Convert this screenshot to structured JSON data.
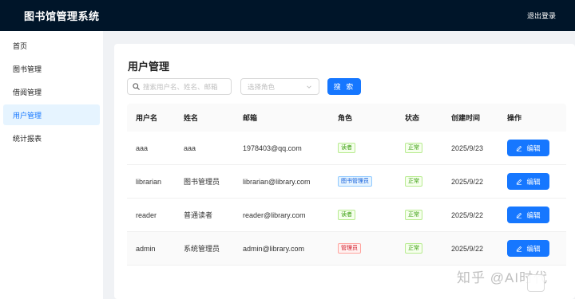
{
  "header": {
    "title": "图书馆管理系统",
    "logout_label": "退出登录"
  },
  "sidebar": {
    "items": [
      {
        "label": "首页"
      },
      {
        "label": "图书管理"
      },
      {
        "label": "借阅管理"
      },
      {
        "label": "用户管理",
        "active": true
      },
      {
        "label": "统计报表"
      }
    ]
  },
  "main": {
    "title": "用户管理",
    "search": {
      "placeholder": "搜索用户名、姓名、邮箱",
      "value": ""
    },
    "role_select": {
      "placeholder": "选择角色"
    },
    "search_button": "搜 索",
    "table": {
      "columns": [
        "用户名",
        "姓名",
        "邮箱",
        "角色",
        "状态",
        "创建时间",
        "操作"
      ],
      "rows": [
        {
          "username": "aaa",
          "name": "aaa",
          "email": "1978403@qq.com",
          "role": "读者",
          "status": "正常",
          "created": "2025/9/23",
          "action": "编辑"
        },
        {
          "username": "librarian",
          "name": "图书管理员",
          "email": "librarian@library.com",
          "role": "图书管理员",
          "status": "正常",
          "created": "2025/9/22",
          "action": "编辑"
        },
        {
          "username": "reader",
          "name": "普通读者",
          "email": "reader@library.com",
          "role": "读者",
          "status": "正常",
          "created": "2025/9/22",
          "action": "编辑"
        },
        {
          "username": "admin",
          "name": "系统管理员",
          "email": "admin@library.com",
          "role": "管理员",
          "status": "正常",
          "created": "2025/9/22",
          "action": "编辑"
        }
      ]
    }
  },
  "watermark": "知乎 @AI时代",
  "colors": {
    "header_bg": "#001529",
    "primary": "#1677ff",
    "reader_tag": "#389e0d",
    "librarian_tag": "#0958d9",
    "admin_tag": "#cf1322",
    "status_ok": "#389e0d"
  }
}
